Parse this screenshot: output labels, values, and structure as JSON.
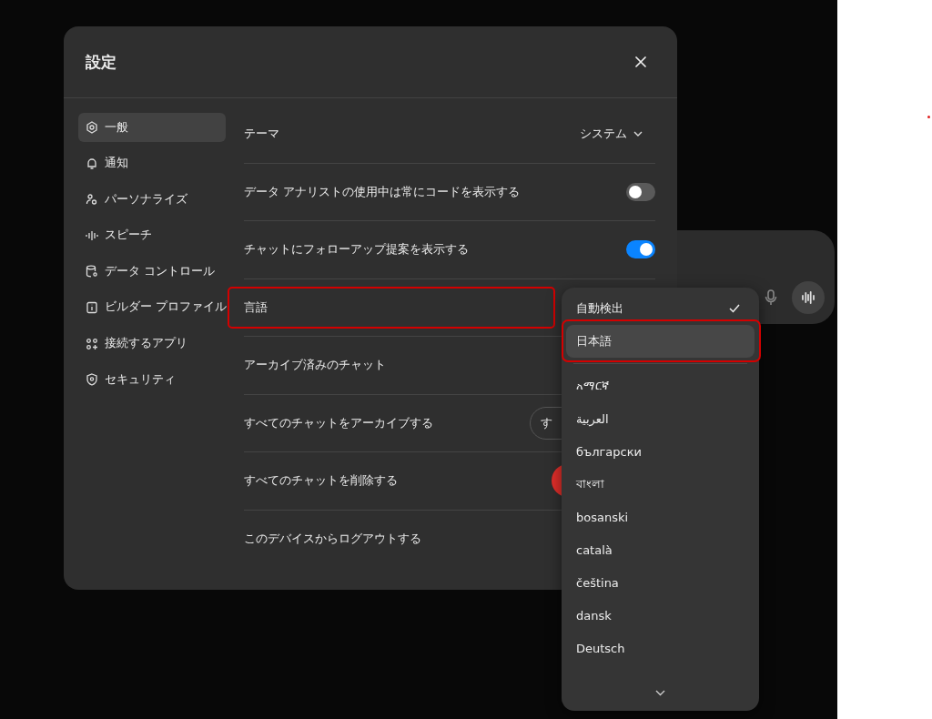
{
  "dialog": {
    "title": "設定"
  },
  "sidebar": {
    "items": [
      {
        "label": "一般",
        "selected": true
      },
      {
        "label": "通知",
        "selected": false
      },
      {
        "label": "パーソナライズ",
        "selected": false
      },
      {
        "label": "スピーチ",
        "selected": false
      },
      {
        "label": "データ コントロール",
        "selected": false
      },
      {
        "label": "ビルダー プロファイル",
        "selected": false
      },
      {
        "label": "接続するアプリ",
        "selected": false
      },
      {
        "label": "セキュリティ",
        "selected": false
      }
    ]
  },
  "rows": [
    {
      "kind": "select",
      "label": "テーマ",
      "value": "システム"
    },
    {
      "kind": "toggle",
      "label": "データ アナリストの使用中は常にコードを表示する",
      "on": false
    },
    {
      "kind": "toggle",
      "label": "チャットにフォローアップ提案を表示する",
      "on": true
    },
    {
      "kind": "plain",
      "label": "言語",
      "annotated": true
    },
    {
      "kind": "plain",
      "label": "アーカイブ済みのチャット"
    },
    {
      "kind": "button",
      "label": "すべてのチャットをアーカイブする",
      "button": "す"
    },
    {
      "kind": "danger",
      "label": "すべてのチャットを削除する"
    },
    {
      "kind": "plain",
      "label": "このデバイスからログアウトする"
    }
  ],
  "language_menu": {
    "options": [
      {
        "kind": "option",
        "label": "自動検出",
        "selected": true,
        "highlighted": false,
        "annotated": false
      },
      {
        "kind": "option",
        "label": "日本語",
        "selected": false,
        "highlighted": true,
        "annotated": true
      },
      {
        "kind": "separator"
      },
      {
        "kind": "option",
        "label": "አማርኛ",
        "selected": false,
        "highlighted": false,
        "annotated": false
      },
      {
        "kind": "option",
        "label": "العربية",
        "selected": false,
        "highlighted": false,
        "annotated": false
      },
      {
        "kind": "option",
        "label": "български",
        "selected": false,
        "highlighted": false,
        "annotated": false
      },
      {
        "kind": "option",
        "label": "বাংলা",
        "selected": false,
        "highlighted": false,
        "annotated": false
      },
      {
        "kind": "option",
        "label": "bosanski",
        "selected": false,
        "highlighted": false,
        "annotated": false
      },
      {
        "kind": "option",
        "label": "català",
        "selected": false,
        "highlighted": false,
        "annotated": false
      },
      {
        "kind": "option",
        "label": "čeština",
        "selected": false,
        "highlighted": false,
        "annotated": false
      },
      {
        "kind": "option",
        "label": "dansk",
        "selected": false,
        "highlighted": false,
        "annotated": false
      },
      {
        "kind": "option",
        "label": "Deutsch",
        "selected": false,
        "highlighted": false,
        "annotated": false
      }
    ]
  }
}
